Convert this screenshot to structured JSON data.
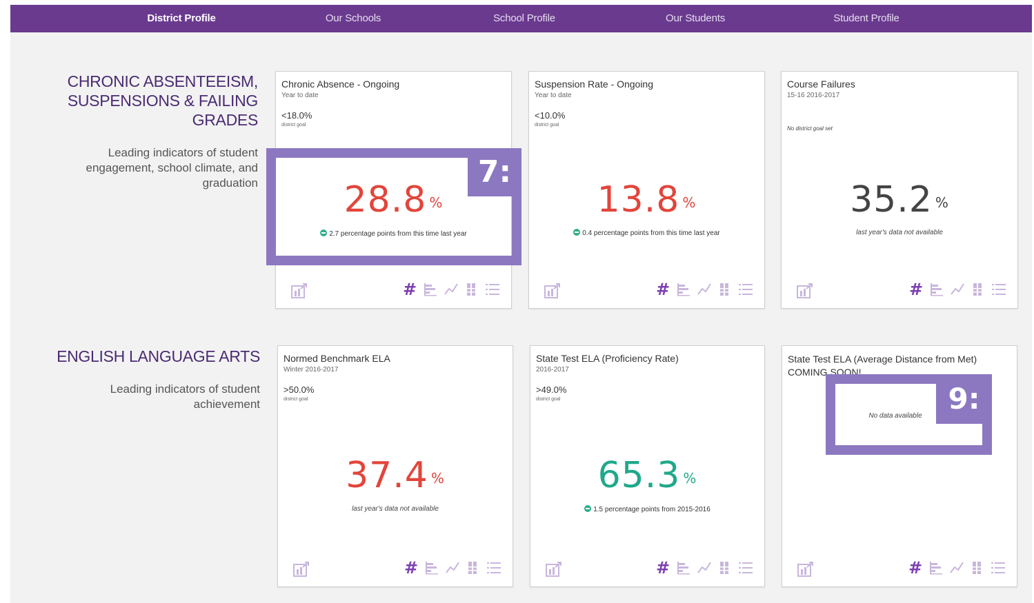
{
  "nav": {
    "items": [
      {
        "label": "District Profile",
        "active": true
      },
      {
        "label": "Our Schools",
        "active": false
      },
      {
        "label": "School Profile",
        "active": false
      },
      {
        "label": "Our Students",
        "active": false
      },
      {
        "label": "Student Profile",
        "active": false
      }
    ]
  },
  "sections": [
    {
      "title_lines": [
        "CHRONIC ABSENTEEISM,",
        "SUSPENSIONS & FAILING",
        "GRADES"
      ],
      "subtitle_lines": [
        "Leading indicators of student",
        "engagement, school climate, and",
        "graduation"
      ]
    },
    {
      "title_lines": [
        "ENGLISH LANGUAGE ARTS"
      ],
      "subtitle_lines": [
        "Leading indicators of student",
        "achievement"
      ]
    }
  ],
  "cards": [
    {
      "title": "Chronic Absence - Ongoing",
      "period": "Year to date",
      "goal": "<18.0%",
      "goal_label": "district goal",
      "value": "28.8",
      "unit": "%",
      "color": "#e2453b",
      "change": "2.7 percentage points from this time last year"
    },
    {
      "title": "Suspension Rate - Ongoing",
      "period": "Year to date",
      "goal": "<10.0%",
      "goal_label": "district goal",
      "value": "13.8",
      "unit": "%",
      "color": "#e2453b",
      "change": "0.4 percentage points from this time last year"
    },
    {
      "title": "Course Failures",
      "period": "15-16 2016-2017",
      "no_goal": "No district goal set",
      "value": "35.2",
      "unit": "%",
      "color": "#444444",
      "note": "last year's data not available"
    },
    {
      "title": "Normed Benchmark ELA",
      "period": "Winter 2016-2017",
      "goal": ">50.0%",
      "goal_label": "district goal",
      "value": "37.4",
      "unit": "%",
      "color": "#e2453b",
      "note": "last year's data not available"
    },
    {
      "title": "State Test ELA (Proficiency Rate)",
      "period": "2016-2017",
      "goal": ">49.0%",
      "goal_label": "district goal",
      "value": "65.3",
      "unit": "%",
      "color": "#1fa88a",
      "change": "1.5 percentage points from 2015-2016"
    },
    {
      "title_lines": [
        "State Test ELA (Average Distance from Met)",
        "COMING SOON!"
      ],
      "no_data": "No data available"
    }
  ],
  "annotations": [
    {
      "label": "7:"
    },
    {
      "label": "9:"
    }
  ],
  "icons": {
    "chart": "chart-export-icon",
    "number": "number-view-icon",
    "bar": "horizontal-bar-icon",
    "line": "line-chart-icon",
    "column": "stacked-column-icon",
    "list": "list-view-icon"
  },
  "colors": {
    "nav": "#6a3a8f",
    "accent": "#7d3fb1",
    "icon_muted": "#c8b6dc",
    "annotation": "#8c78c1"
  }
}
